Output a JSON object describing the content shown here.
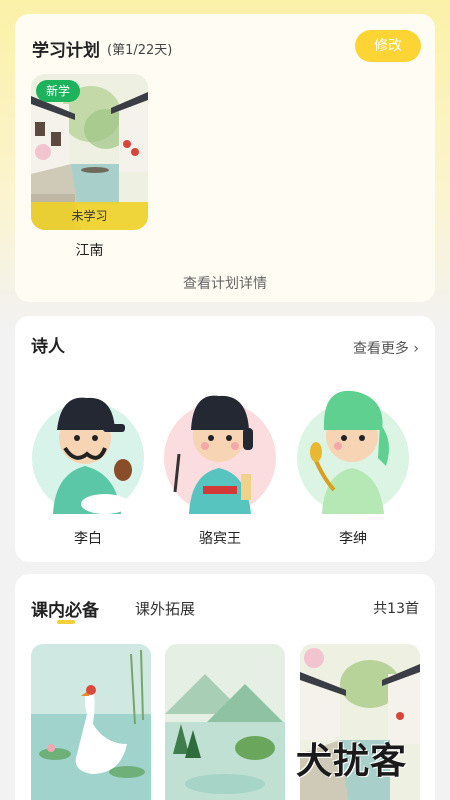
{
  "plan": {
    "title": "学习计划",
    "day_progress": "(第1/22天)",
    "edit_label": "修改",
    "item": {
      "tag": "新学",
      "status": "未学习",
      "name": "江南"
    },
    "detail_link": "查看计划详情"
  },
  "poets": {
    "title": "诗人",
    "more_label": "查看更多",
    "items": [
      {
        "name": "李白",
        "circle_color": "#d8f3ea"
      },
      {
        "name": "骆宾王",
        "circle_color": "#fbdde0"
      },
      {
        "name": "李绅",
        "circle_color": "#dcf4e4"
      }
    ]
  },
  "poems": {
    "tabs": [
      {
        "label": "课内必备"
      },
      {
        "label": "课外拓展"
      }
    ],
    "count": "共13首"
  },
  "watermark": "犬扰客",
  "colors": {
    "accent_yellow": "#fcd535",
    "tag_green": "#1db35c"
  }
}
